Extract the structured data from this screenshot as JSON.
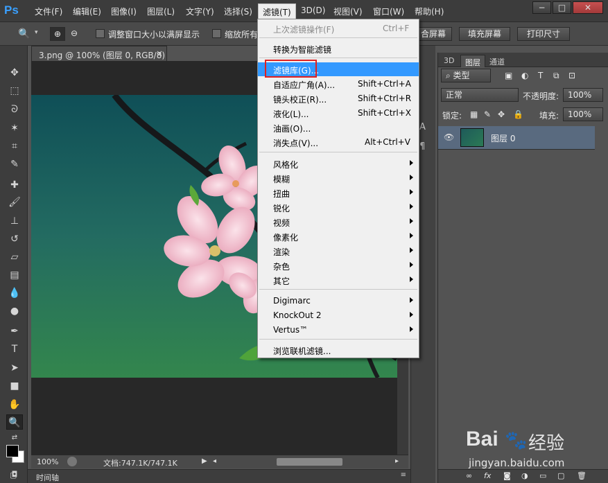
{
  "app": {
    "logo": "Ps"
  },
  "menubar": {
    "items": [
      "文件(F)",
      "编辑(E)",
      "图像(I)",
      "图层(L)",
      "文字(Y)",
      "选择(S)",
      "滤镜(T)",
      "3D(D)",
      "视图(V)",
      "窗口(W)",
      "帮助(H)"
    ],
    "active_index": 6,
    "window_buttons": [
      "−",
      "□",
      "✕"
    ]
  },
  "options": {
    "checkbox1_label": "调整窗口大小以满屏显示",
    "checkbox2_label": "缩放所有",
    "btn_fill_screen_partial": "合屏幕",
    "btn_fill_screen": "填充屏幕",
    "btn_print_size": "打印尺寸"
  },
  "document": {
    "tab_title": "3.png @ 100% (图层 0, RGB/8)",
    "close_glyph": "×",
    "zoom": "100%",
    "doc_info": "文档:747.1K/747.1K"
  },
  "timeline": {
    "label": "时间轴"
  },
  "filter_menu": {
    "items": [
      {
        "label": "上次滤镜操作(F)",
        "shortcut": "Ctrl+F",
        "disabled": true
      },
      {
        "label": "转换为智能滤镜"
      },
      {
        "label": "滤镜库(G)...",
        "highlight": true
      },
      {
        "label": "自适应广角(A)...",
        "shortcut": "Shift+Ctrl+A"
      },
      {
        "label": "镜头校正(R)...",
        "shortcut": "Shift+Ctrl+R"
      },
      {
        "label": "液化(L)...",
        "shortcut": "Shift+Ctrl+X"
      },
      {
        "label": "油画(O)..."
      },
      {
        "label": "消失点(V)...",
        "shortcut": "Alt+Ctrl+V"
      },
      {
        "label": "风格化",
        "submenu": true
      },
      {
        "label": "模糊",
        "submenu": true
      },
      {
        "label": "扭曲",
        "submenu": true
      },
      {
        "label": "锐化",
        "submenu": true
      },
      {
        "label": "视频",
        "submenu": true
      },
      {
        "label": "像素化",
        "submenu": true
      },
      {
        "label": "渲染",
        "submenu": true
      },
      {
        "label": "杂色",
        "submenu": true
      },
      {
        "label": "其它",
        "submenu": true
      },
      {
        "label": "Digimarc",
        "submenu": true
      },
      {
        "label": "KnockOut 2",
        "submenu": true
      },
      {
        "label": "Vertus™",
        "submenu": true
      },
      {
        "label": "浏览联机滤镜..."
      }
    ]
  },
  "layers_panel": {
    "tabs": [
      "3D",
      "图层",
      "通道"
    ],
    "active_tab": 1,
    "filter_kind": "类型",
    "blend_mode": "正常",
    "opacity_label": "不透明度:",
    "opacity_value": "100%",
    "lock_label": "锁定:",
    "fill_label": "填充:",
    "fill_value": "100%",
    "layer_name": "图层 0",
    "footer_icons": [
      "link-icon",
      "fx-icon",
      "mask-icon",
      "adjustment-icon",
      "folder-icon",
      "new-layer-icon",
      "trash-icon"
    ]
  },
  "watermark": {
    "brand": "Bai",
    "brand_suffix": "经验",
    "url": "jingyan.baidu.com"
  },
  "colors": {
    "highlight": "#3399ff",
    "red_box": "#e02020",
    "ps_blue": "#3aa0ff"
  }
}
